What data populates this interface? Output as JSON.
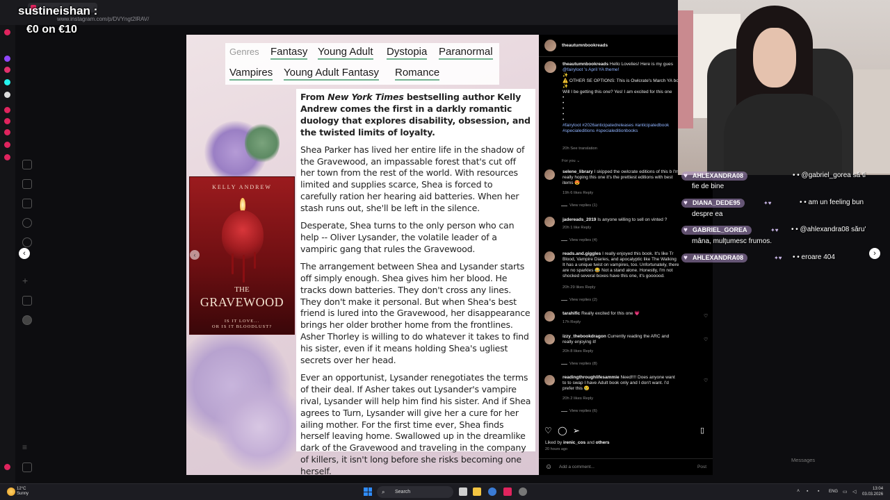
{
  "overlay": {
    "streamer_name": "sustineishan :",
    "goal": "€0 on €10"
  },
  "browser": {
    "url": "www.instagram.com/p/DVYngt2lRAV/"
  },
  "post": {
    "genres_label": "Genres",
    "genres": [
      "Fantasy",
      "Young Adult",
      "Dystopia",
      "Paranormal",
      "Vampires",
      "Young Adult Fantasy",
      "Romance"
    ],
    "cover": {
      "author": "KELLY ANDREW",
      "title_the": "THE",
      "title": "GRAVEWOOD",
      "tagline_1": "IS IT LOVE...",
      "tagline_2": "OR IS IT BLOODLUST?"
    },
    "blurb": {
      "lead_1": "From ",
      "lead_italic": "New York Times",
      "lead_2": " bestselling author Kelly Andrew comes the first in a darkly romantic duology that explores disability, obsession, and the twisted limits of loyalty.",
      "p1": "Shea Parker has lived her entire life in the shadow of the Gravewood, an impassable forest that's cut off her town from the rest of the world. With resources limited and supplies scarce, Shea is forced to carefully ration her hearing aid batteries. When her stash runs out, she'll be left in the silence.",
      "p2": "Desperate, Shea turns to the only person who can help -- Oliver Lysander, the volatile leader of a vampiric gang that rules the Gravewood.",
      "p3": "The arrangement between Shea and Lysander starts off simply enough. Shea gives him her blood. He tracks down batteries. They don't cross any lines. They don't make it personal. But when Shea's best friend is lured into the Gravewood, her disappearance brings her older brother home from the frontlines. Asher Thorley is willing to do whatever it takes to find his sister, even if it means holding Shea's ugliest secrets over her head.",
      "p4": "Ever an opportunist, Lysander renegotiates the terms of their deal. If Asher takes out Lysander's vampire rival, Lysander will help him find his sister. And if Shea agrees to Turn, Lysander will give her a cure for her ailing mother. For the first time ever, Shea finds herself leaving home. Swallowed up in the dreamlike dark of the Gravewood and traveling in the company of killers, it isn't long before she risks becoming one herself."
    }
  },
  "comments": {
    "header_user": "theautumnbookreads",
    "caption": {
      "user": "theautumnbookreads",
      "line1": "Hello Lovelies! Here is my gues",
      "line2": "@fairyloot 's April YA theme!",
      "line3": "✨",
      "line4": "⚠️ OTHER SE OPTIONS: This is Owlcrate's March YA bo",
      "line5": "✨",
      "line6": "Will I be getting this one? Yes! I am excited for this one",
      "dots": "•\n•\n•\n•\n•",
      "tags1": "#fairyloot #2026anticipatedreleases #anticipatedbook",
      "tags2": "#specialeditions #specialeditionbooks",
      "meta": "20h   See translation"
    },
    "for_you": "For you ⌄",
    "items": [
      {
        "user": "selene_library",
        "text": "I skipped the owlcrate editions of this b I'm really hoping this one it's the prettiest editions with best items 😍",
        "meta": "19h   6 likes   Reply",
        "view": "View replies (1)"
      },
      {
        "user": "jadereads_2019",
        "text": "Is anyone willing to sell on vinted ?",
        "meta": "20h   1 like   Reply",
        "view": "View replies (4)"
      },
      {
        "user": "reads.and.giggles",
        "text": "I really enjoyed this book. It's like Tr Blood, Vampire Diaries, and apocalyptic like The Walking It has a unique twist on vampires, too. Unfortunately, there are no sparkles 😂 Not a stand alone. Honestly, I'm not shocked several boxes have this one, it's goooood.",
        "meta": "20h   29 likes   Reply",
        "view": "View replies (2)"
      },
      {
        "user": "tarahific",
        "text": "Really excited for this one 💗",
        "meta": "17h   Reply",
        "view": ""
      },
      {
        "user": "izzy_thebookdragon",
        "text": "Currently reading the ARC and really enjoying it!",
        "meta": "20h   8 likes   Reply",
        "view": "View replies (8)"
      },
      {
        "user": "readingthroughlifesammie",
        "text": "Need!!!! Does anyone want to to swap I have Adult book only and I don't want. I'd prefer this 😢",
        "meta": "20h   2 likes   Reply",
        "view": "View replies (6)"
      }
    ],
    "liked_by_prefix": "Liked by ",
    "liked_by_user": "irenic_cos",
    "liked_by_mid": " and ",
    "liked_by_others": "others",
    "time_ago": "20 hours ago",
    "add_comment_placeholder": "Add a comment...",
    "post_button": "Post"
  },
  "chat": {
    "line0": "• • @gabriel_gorea să ti",
    "line0b": "fie de bine",
    "messages": [
      {
        "user": "DIANA_DEDE95",
        "text": "• • am un feeling bun",
        "cont": "despre ea"
      },
      {
        "user": "GABRIEL_GOREA",
        "text": "• • @ahlexandra08 săru'",
        "cont": "mâna, mulțumesc frumos."
      },
      {
        "user": "AHLEXANDRA08",
        "text": "• • eroare 404",
        "cont": ""
      }
    ],
    "top_user": "AHLEXANDRA08",
    "messages_label": "Messages"
  },
  "taskbar": {
    "temp": "12°C",
    "weather": "Sunny",
    "search": "Search",
    "lang": "ENG",
    "time": "13:04",
    "date": "03.03.2026"
  }
}
